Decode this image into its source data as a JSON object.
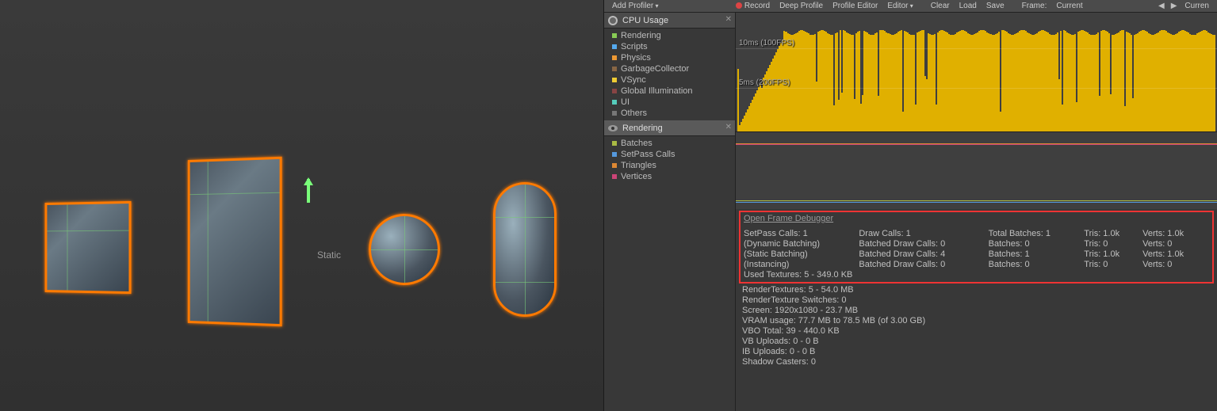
{
  "scene": {
    "static_label": "Static"
  },
  "toolbar": {
    "add_profiler": "Add Profiler",
    "record": "Record",
    "deep_profile": "Deep Profile",
    "profile_editor": "Profile Editor",
    "editor": "Editor",
    "clear": "Clear",
    "load": "Load",
    "save": "Save",
    "frame_label": "Frame:",
    "frame_value": "Current",
    "current": "Curren"
  },
  "cpu_module": {
    "title": "CPU Usage",
    "categories": [
      {
        "label": "Rendering",
        "color": "#88cc55"
      },
      {
        "label": "Scripts",
        "color": "#55aaee"
      },
      {
        "label": "Physics",
        "color": "#ee9933"
      },
      {
        "label": "GarbageCollector",
        "color": "#886644"
      },
      {
        "label": "VSync",
        "color": "#eecc33"
      },
      {
        "label": "Global Illumination",
        "color": "#884444"
      },
      {
        "label": "UI",
        "color": "#55ccbb"
      },
      {
        "label": "Others",
        "color": "#777777"
      }
    ],
    "gridlines": [
      {
        "label": "10ms (100FPS)",
        "pos": 45
      },
      {
        "label": "5ms (200FPS)",
        "pos": 95
      }
    ]
  },
  "render_module": {
    "title": "Rendering",
    "categories": [
      {
        "label": "Batches",
        "color": "#aabb44"
      },
      {
        "label": "SetPass Calls",
        "color": "#5599dd"
      },
      {
        "label": "Triangles",
        "color": "#dd8833"
      },
      {
        "label": "Vertices",
        "color": "#cc4477"
      }
    ]
  },
  "stats": {
    "debugger_link": "Open Frame Debugger",
    "boxed_rows": [
      {
        "c1": "SetPass Calls: 1",
        "c2": "Draw Calls: 1",
        "c3": "Total Batches: 1",
        "c4": "Tris: 1.0k",
        "c5": "Verts: 1.0k"
      },
      {
        "c1": "(Dynamic Batching)",
        "c2": "Batched Draw Calls: 0",
        "c3": "Batches: 0",
        "c4": "Tris: 0",
        "c5": "Verts: 0"
      },
      {
        "c1": "(Static Batching)",
        "c2": "Batched Draw Calls: 4",
        "c3": "Batches: 1",
        "c4": "Tris: 1.0k",
        "c5": "Verts: 1.0k"
      },
      {
        "c1": "(Instancing)",
        "c2": "Batched Draw Calls: 0",
        "c3": "Batches: 0",
        "c4": "Tris: 0",
        "c5": "Verts: 0"
      }
    ],
    "boxed_tail": "Used Textures: 5 - 349.0 KB",
    "lines": [
      "RenderTextures: 5 - 54.0 MB",
      "RenderTexture Switches: 0",
      "Screen: 1920x1080 - 23.7 MB",
      "VRAM usage: 77.7 MB to 78.5 MB (of 3.00 GB)",
      "VBO Total: 39 - 440.0 KB",
      "VB Uploads: 0 - 0 B",
      "IB Uploads: 0 - 0 B",
      "Shadow Casters: 0"
    ]
  },
  "chart_data": {
    "type": "bar",
    "title": "CPU Usage",
    "ylabel": "ms",
    "ylim": [
      0,
      16
    ],
    "gridlines_ms": [
      5,
      10
    ],
    "approx_frame_count": 300,
    "dominant_category": "VSync",
    "typical_value_ms": 12,
    "spikes_down_to_ms": 1
  }
}
